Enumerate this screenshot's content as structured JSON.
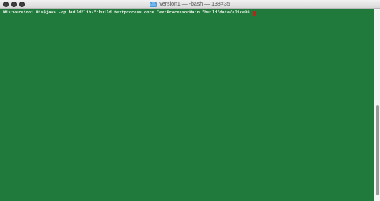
{
  "window": {
    "title": "version1 — -bash — 138×35"
  },
  "terminal": {
    "prompt": "Mis:version1 Mis$",
    "command": "java -cp build/lib/*:build textprocess.core.TextProcessorMain \"build/data/alice30."
  },
  "colors": {
    "background": "#1f7a3c",
    "text": "#f2f5ef",
    "cursor": "#b12a1b"
  },
  "icons": {
    "close": "close-icon",
    "minimize": "minimize-icon",
    "zoom": "zoom-icon",
    "folder": "folder-icon"
  }
}
